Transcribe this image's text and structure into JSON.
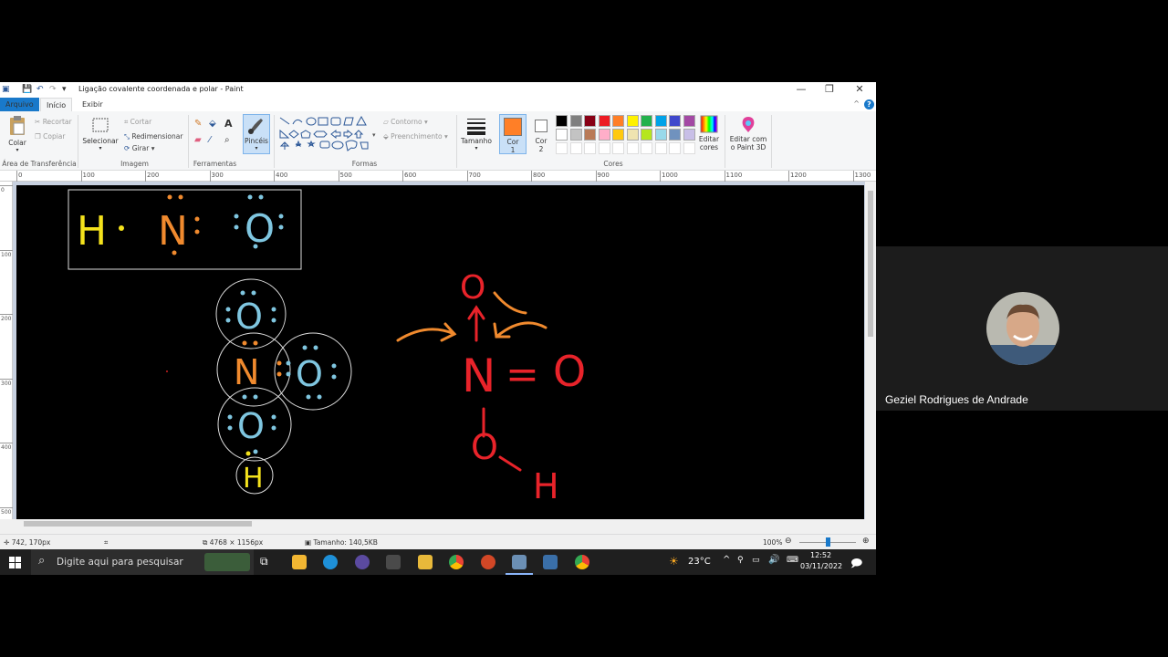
{
  "window": {
    "title": "Ligação covalente coordenada e polar - Paint",
    "controls": {
      "minimize": "—",
      "maximize": "❐",
      "close": "✕"
    }
  },
  "tabs": {
    "file": "Arquivo",
    "home": "Início",
    "view": "Exibir",
    "help": "?"
  },
  "ribbon": {
    "clipboard": {
      "paste": "Colar",
      "cut": "Recortar",
      "copy": "Copiar",
      "label": "Área de Transferência"
    },
    "image": {
      "select": "Selecionar",
      "crop": "Cortar",
      "resize": "Redimensionar",
      "rotate": "Girar",
      "label": "Imagem"
    },
    "tools": {
      "brushes": "Pincéis",
      "label": "Ferramentas"
    },
    "shapes": {
      "outline": "Contorno",
      "fill": "Preenchimento",
      "label": "Formas"
    },
    "size": "Tamanho",
    "color1": {
      "line1": "Cor",
      "line2": "1",
      "value": "#ff7f27"
    },
    "color2": {
      "line1": "Cor",
      "line2": "2",
      "value": "#ffffff"
    },
    "colors_label": "Cores",
    "palette_row1": [
      "#000000",
      "#7f7f7f",
      "#880015",
      "#ed1c24",
      "#ff7f27",
      "#fff200",
      "#22b14c",
      "#00a2e8",
      "#3f48cc",
      "#a349a4"
    ],
    "palette_row2": [
      "#ffffff",
      "#c3c3c3",
      "#b97a57",
      "#ffaec9",
      "#ffc90e",
      "#efe4b0",
      "#b5e61d",
      "#99d9ea",
      "#7092be",
      "#c8bfe7"
    ],
    "edit_colors": {
      "line1": "Editar",
      "line2": "cores"
    },
    "paint3d": {
      "line1": "Editar com",
      "line2": "o Paint 3D"
    }
  },
  "ruler": {
    "h": [
      "0",
      "100",
      "200",
      "300",
      "400",
      "500",
      "600",
      "700",
      "800",
      "900",
      "1000",
      "1100",
      "1200",
      "1300"
    ],
    "v": [
      "0",
      "100",
      "200",
      "300",
      "400",
      "500"
    ]
  },
  "canvas": {
    "box": {
      "h": "H",
      "n": "N",
      "o": "O"
    },
    "circles": {
      "o_top": "O",
      "n": "N",
      "o_right": "O",
      "o_bottom": "O",
      "h": "H"
    },
    "structure": {
      "o_top": "O",
      "n": "N",
      "eq": "=",
      "o_right": "O",
      "o_bottom": "O",
      "h": "H"
    },
    "colors": {
      "hydrogen": "#f4e21c",
      "nitrogen": "#f08a2e",
      "oxygen": "#7fc6e0",
      "red": "#e8232a",
      "arrow": "#f08a2e"
    }
  },
  "status": {
    "cursor": "742, 170px",
    "canvas_size": "4768 × 1156px",
    "file_size": "Tamanho: 140,5KB",
    "zoom": "100%"
  },
  "taskbar": {
    "search_placeholder": "Digite aqui para pesquisar",
    "weather": "23°C",
    "time": "12:52",
    "date": "03/11/2022"
  },
  "webcam": {
    "name": "Geziel Rodrigues de Andrade"
  }
}
